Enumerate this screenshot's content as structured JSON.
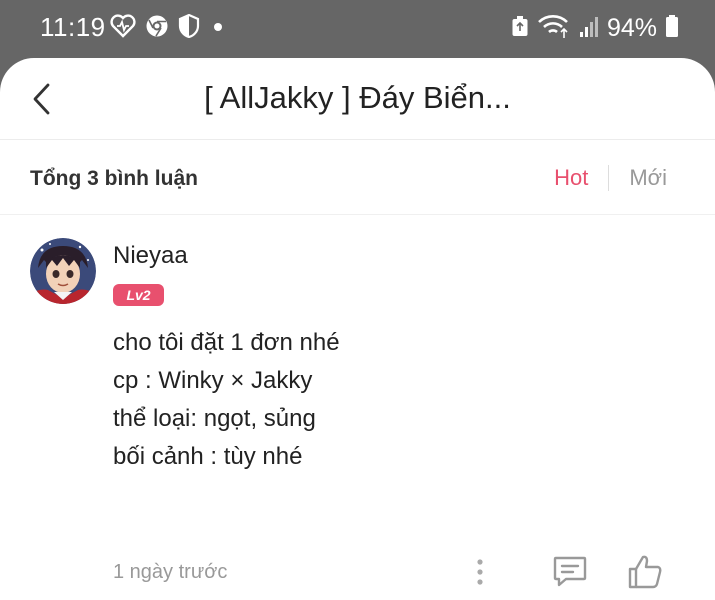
{
  "status_bar": {
    "time": "11:19",
    "battery": "94%",
    "icons": [
      "heart-rate-icon",
      "browser-icon",
      "shield-icon",
      "notification-dot-icon",
      "recycle-icon",
      "wifi-icon",
      "signal-icon",
      "battery-icon"
    ]
  },
  "header": {
    "title": "[ AllJakky ] Đáy Biển..."
  },
  "subheader": {
    "count_label": "Tổng 3 bình luận",
    "tabs": [
      {
        "label": "Hot",
        "active": true,
        "color": "#e8506e"
      },
      {
        "label": "Mới",
        "active": false,
        "color": "#999999"
      }
    ]
  },
  "comment": {
    "username": "Nieyaa",
    "level": "Lv2",
    "lines": [
      "cho tôi đặt 1 đơn nhé",
      "cp : Winky × Jakky",
      "thể loại: ngọt, sủng",
      "bối cảnh : tùy nhé"
    ],
    "time": "1 ngày trước"
  },
  "colors": {
    "accent": "#e8506e",
    "status_bar": "#666666",
    "text": "#222222",
    "muted": "#999999"
  }
}
